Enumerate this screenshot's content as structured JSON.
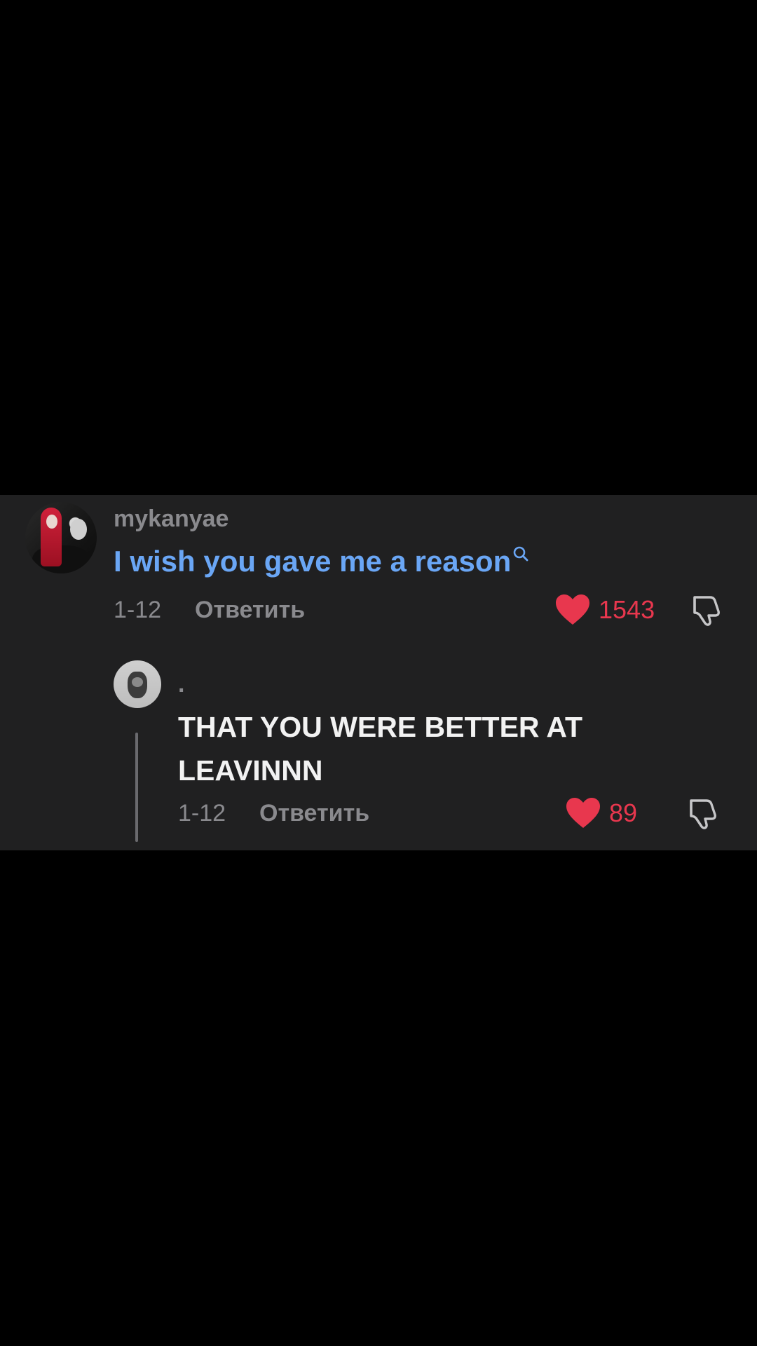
{
  "comment": {
    "username": "mykanyae",
    "text": "I wish you gave me a reason",
    "date": "1-12",
    "reply_label": "Ответить",
    "likes": "1543"
  },
  "reply": {
    "username": ".",
    "text": "THAT YOU WERE BETTER AT LEAVINNN",
    "date": "1-12",
    "reply_label": "Ответить",
    "likes": "89"
  },
  "icons": {
    "like": "heart-icon",
    "dislike": "thumbs-down-icon",
    "search": "search-icon"
  },
  "colors": {
    "background": "#000000",
    "panel": "#202021",
    "link_text": "#6aa6f5",
    "secondary_text": "#8a8a8e",
    "like_red": "#e8374e",
    "primary_text": "#f2f2f2"
  }
}
